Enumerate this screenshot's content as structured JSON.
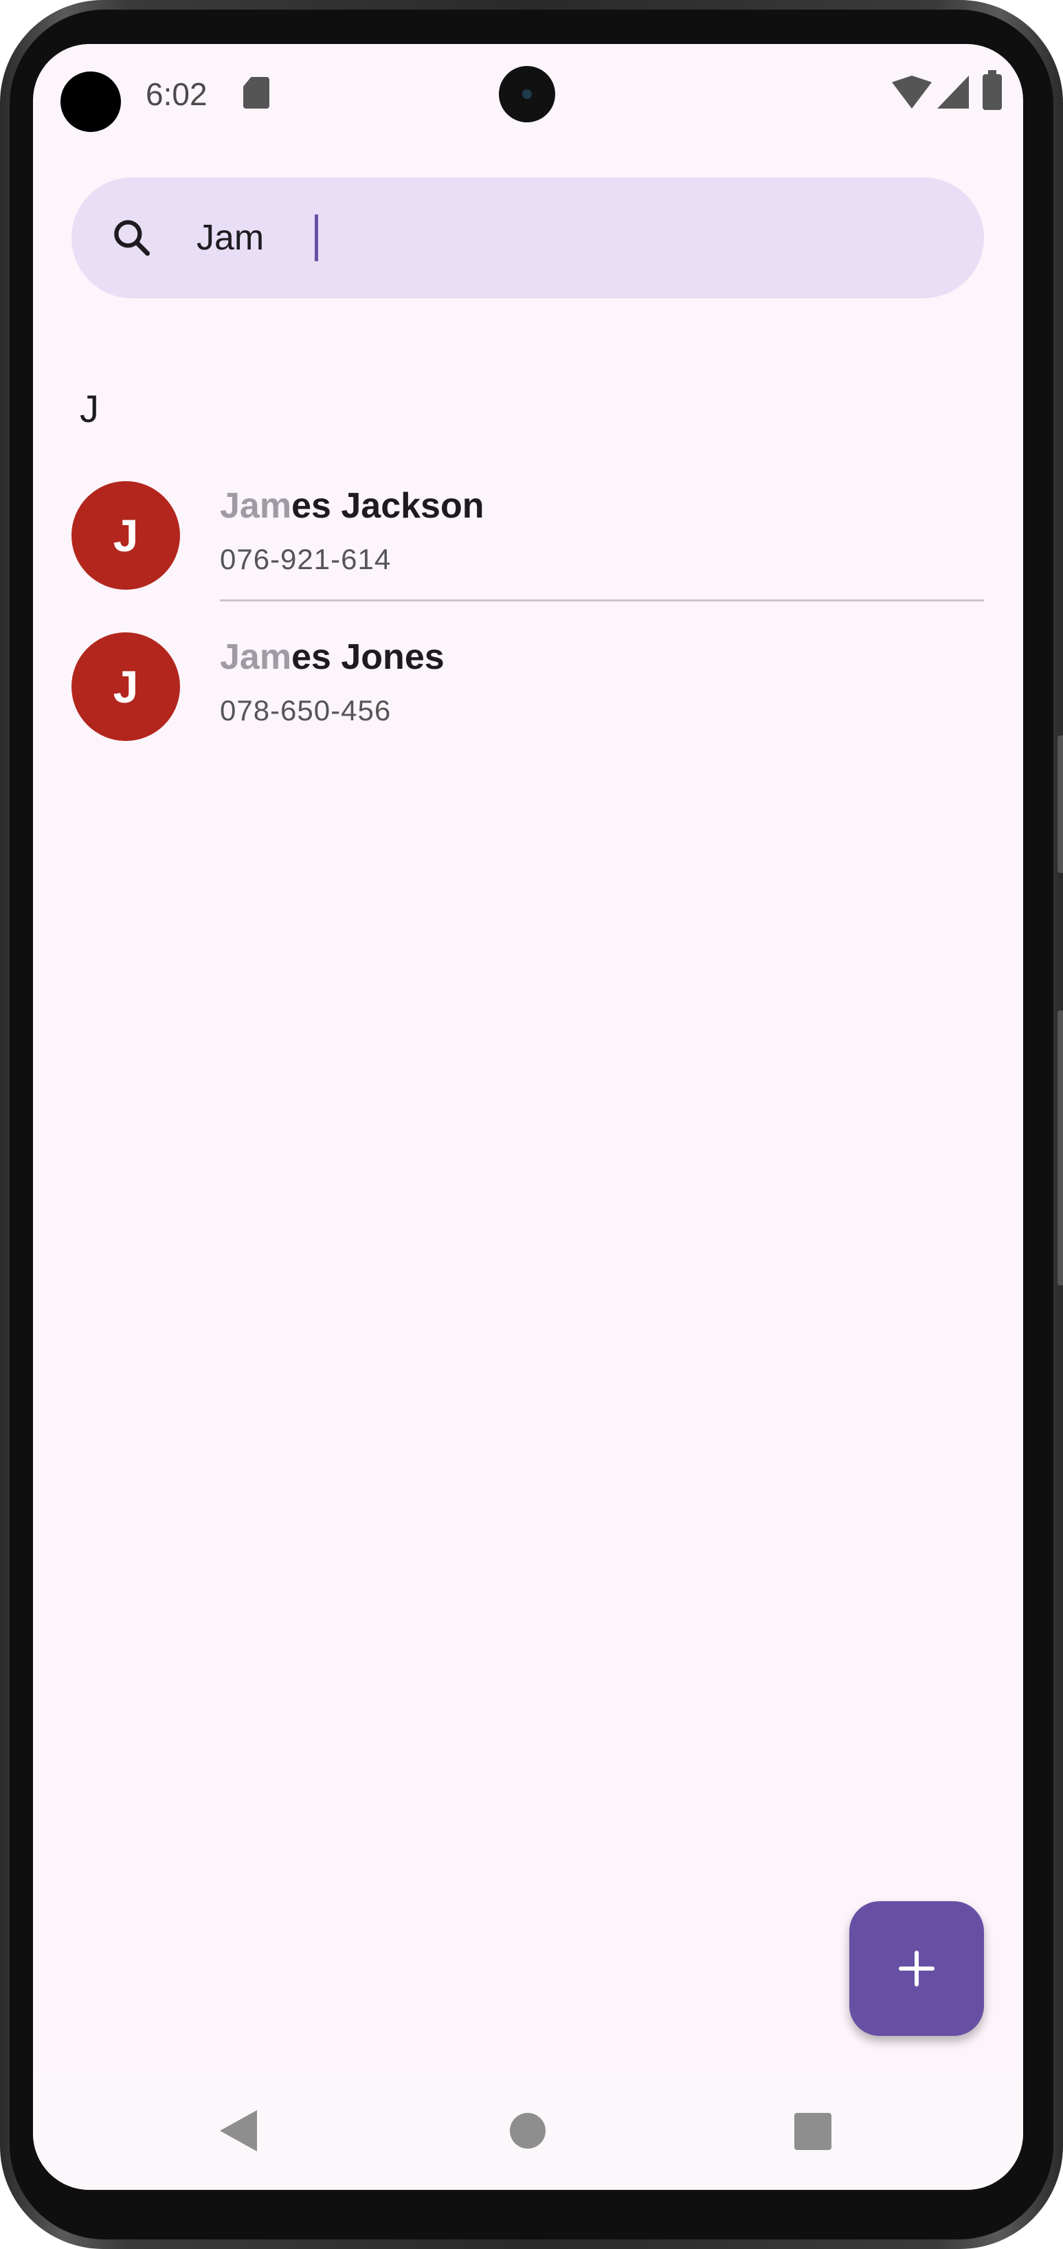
{
  "status_bar": {
    "time": "6:02",
    "icons": [
      "sd-card-icon",
      "wifi-icon",
      "signal-icon",
      "battery-icon"
    ]
  },
  "search": {
    "query": "Jam",
    "placeholder": ""
  },
  "section": {
    "letter": "J"
  },
  "contacts": [
    {
      "initial": "J",
      "name_match": "Jam",
      "name_rest": "es Jackson",
      "phone": "076-921-614"
    },
    {
      "initial": "J",
      "name_match": "Jam",
      "name_rest": "es Jones",
      "phone": "078-650-456"
    }
  ],
  "colors": {
    "background": "#fcf5fb",
    "search_bg": "#e8def5",
    "avatar": "#b3261e",
    "accent": "#6750a4",
    "match_text": "#9f9aa3"
  },
  "fab": {
    "icon": "plus-icon"
  },
  "nav": {
    "back_icon": "back-icon",
    "home_icon": "home-icon",
    "recents_icon": "recents-icon"
  }
}
